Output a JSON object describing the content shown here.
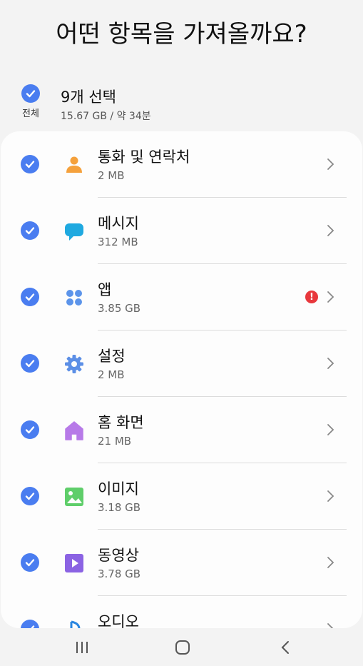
{
  "header": {
    "title": "어떤 항목을 가져올까요?"
  },
  "select_all": {
    "label": "전체",
    "summary": "9개 선택",
    "detail": "15.67 GB / 약 34분",
    "checked": true
  },
  "items": [
    {
      "name": "통화 및 연락처",
      "size": "2 MB",
      "icon": "contact-icon",
      "color": "#f5a13c",
      "checked": true,
      "warning": false
    },
    {
      "name": "메시지",
      "size": "312 MB",
      "icon": "message-icon",
      "color": "#1fa9e0",
      "checked": true,
      "warning": false
    },
    {
      "name": "앱",
      "size": "3.85 GB",
      "icon": "apps-icon",
      "color": "#5c94ea",
      "checked": true,
      "warning": true,
      "warning_symbol": "!"
    },
    {
      "name": "설정",
      "size": "2 MB",
      "icon": "gear-icon",
      "color": "#5c8fe6",
      "checked": true,
      "warning": false
    },
    {
      "name": "홈 화면",
      "size": "21 MB",
      "icon": "home-icon",
      "color": "#b77ae8",
      "checked": true,
      "warning": false
    },
    {
      "name": "이미지",
      "size": "3.18 GB",
      "icon": "image-icon",
      "color": "#5fce6a",
      "checked": true,
      "warning": false
    },
    {
      "name": "동영상",
      "size": "3.78 GB",
      "icon": "video-icon",
      "color": "#8b63e3",
      "checked": true,
      "warning": false
    },
    {
      "name": "오디오",
      "size": "",
      "icon": "audio-icon",
      "color": "#2a86e0",
      "checked": true,
      "warning": false
    }
  ],
  "accent_color": "#4a7df0",
  "nav": {
    "buttons": [
      "recent-apps-icon",
      "home-button-icon",
      "back-icon"
    ]
  }
}
